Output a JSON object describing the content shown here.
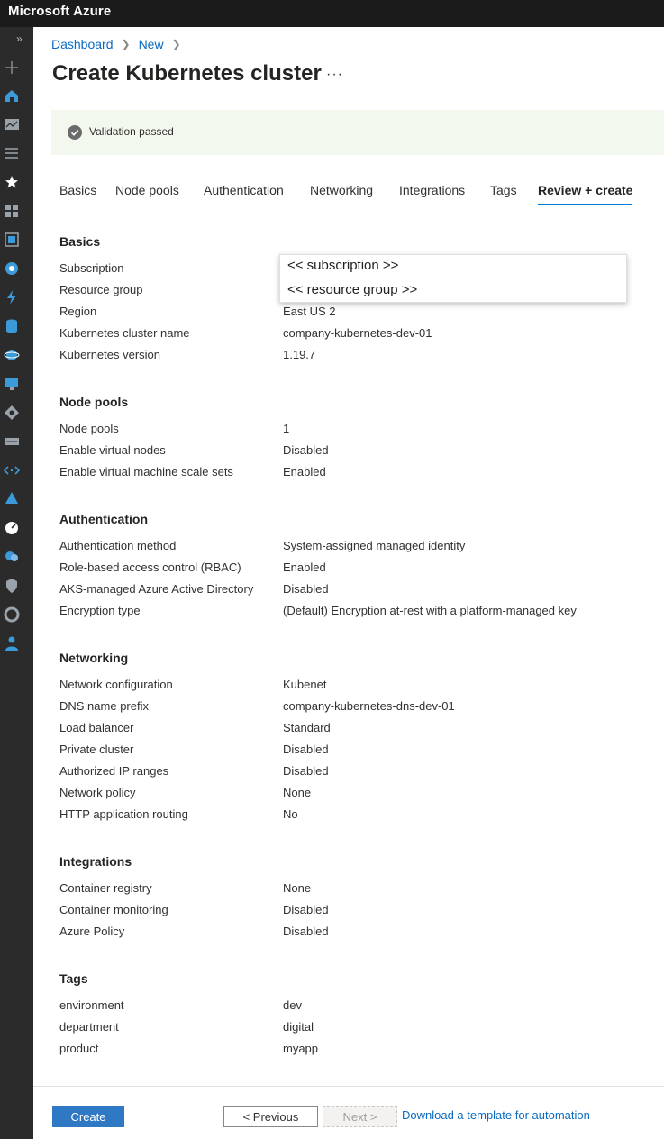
{
  "app": {
    "title": "Microsoft Azure"
  },
  "breadcrumb": [
    "Dashboard",
    "New"
  ],
  "page": {
    "title": "Create Kubernetes cluster",
    "more_label": "···"
  },
  "banner": {
    "message": "Validation passed"
  },
  "tabs": [
    {
      "label": "Basics"
    },
    {
      "label": "Node pools"
    },
    {
      "label": "Authentication"
    },
    {
      "label": "Networking"
    },
    {
      "label": "Integrations"
    },
    {
      "label": "Tags"
    },
    {
      "label": "Review + create",
      "active": true
    }
  ],
  "sections": {
    "basics": {
      "heading": "Basics",
      "rows": [
        {
          "label": "Subscription",
          "value": ""
        },
        {
          "label": "Resource group",
          "value": ""
        },
        {
          "label": "Region",
          "value": "East US 2"
        },
        {
          "label": "Kubernetes cluster name",
          "value": "company-kubernetes-dev-01"
        },
        {
          "label": "Kubernetes version",
          "value": "1.19.7"
        }
      ]
    },
    "node_pools": {
      "heading": "Node pools",
      "rows": [
        {
          "label": "Node pools",
          "value": "1"
        },
        {
          "label": "Enable virtual nodes",
          "value": "Disabled"
        },
        {
          "label": "Enable virtual machine scale sets",
          "value": "Enabled"
        }
      ]
    },
    "authentication": {
      "heading": "Authentication",
      "rows": [
        {
          "label": "Authentication method",
          "value": "System-assigned managed identity"
        },
        {
          "label": "Role-based access control (RBAC)",
          "value": "Enabled"
        },
        {
          "label": "AKS-managed Azure Active Directory",
          "value": "Disabled"
        },
        {
          "label": "Encryption type",
          "value": "(Default) Encryption at-rest with a platform-managed key"
        }
      ]
    },
    "networking": {
      "heading": "Networking",
      "rows": [
        {
          "label": "Network configuration",
          "value": "Kubenet"
        },
        {
          "label": "DNS name prefix",
          "value": "company-kubernetes-dns-dev-01"
        },
        {
          "label": "Load balancer",
          "value": "Standard"
        },
        {
          "label": "Private cluster",
          "value": "Disabled"
        },
        {
          "label": "Authorized IP ranges",
          "value": "Disabled"
        },
        {
          "label": "Network policy",
          "value": "None"
        },
        {
          "label": "HTTP application routing",
          "value": "No"
        }
      ]
    },
    "integrations": {
      "heading": "Integrations",
      "rows": [
        {
          "label": "Container registry",
          "value": "None"
        },
        {
          "label": "Container monitoring",
          "value": "Disabled"
        },
        {
          "label": "Azure Policy",
          "value": "Disabled"
        }
      ]
    },
    "tags": {
      "heading": "Tags",
      "rows": [
        {
          "label": "environment",
          "value": "dev"
        },
        {
          "label": "department",
          "value": "digital"
        },
        {
          "label": "product",
          "value": "myapp"
        }
      ]
    }
  },
  "overlay": {
    "subscription": "<< subscription >>",
    "resource_group": "<< resource group >>"
  },
  "footer": {
    "create_label": "Create",
    "previous_label": "< Previous",
    "next_label": "Next >",
    "template_link": "Download a template for automation"
  },
  "nav_icons": [
    "expand-icon",
    "plus-icon",
    "home-icon",
    "dashboard-icon",
    "all-services-icon",
    "favorites-star-icon",
    "all-resources-icon",
    "resource-groups-icon",
    "app-services-icon",
    "function-app-icon",
    "sql-database-icon",
    "cosmos-db-icon",
    "virtual-machine-icon",
    "load-balancer-icon",
    "storage-account-icon",
    "virtual-network-icon",
    "active-directory-icon",
    "monitor-icon",
    "advisor-icon",
    "security-center-icon",
    "cost-management-icon",
    "help-support-icon"
  ]
}
